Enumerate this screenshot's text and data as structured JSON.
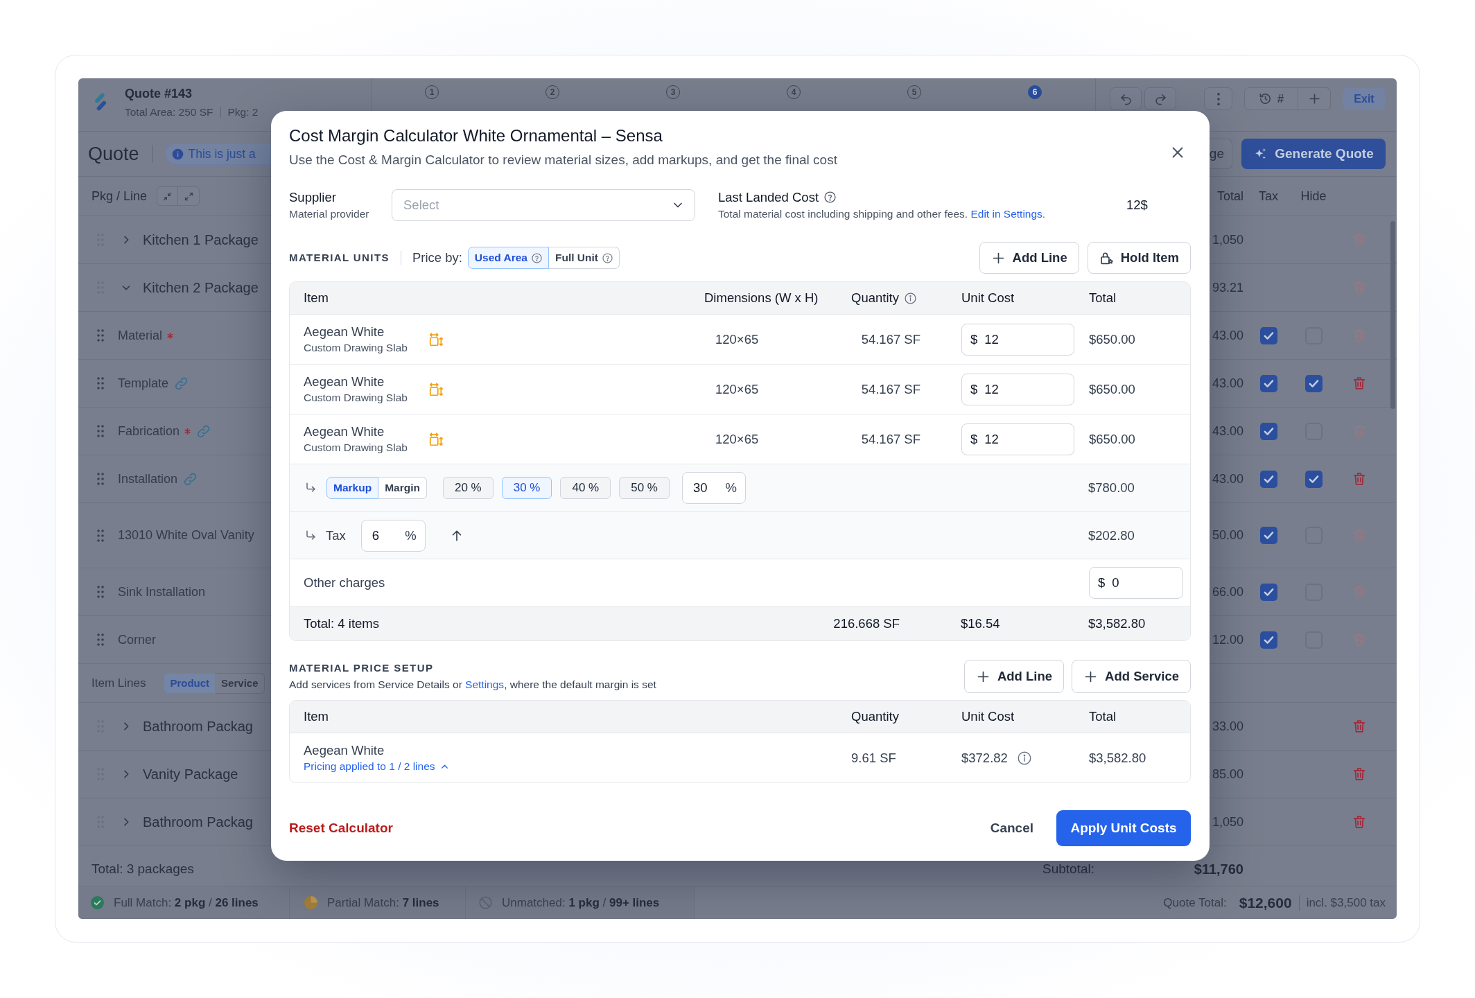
{
  "quote_app": {
    "header": {
      "title": "Quote #143",
      "total_area": "Total Area: 250 SF",
      "packages": "Pkg: 2"
    },
    "steps": [
      {
        "number": "1",
        "selected": false
      },
      {
        "number": "2",
        "selected": false
      },
      {
        "number": "3",
        "selected": false
      },
      {
        "number": "4",
        "selected": false
      },
      {
        "number": "5",
        "selected": false
      },
      {
        "number": "6",
        "selected": true
      }
    ],
    "toolbar": {
      "history_label": "#",
      "exit": "Exit"
    },
    "page_title": "Quote",
    "notice": "This is just a",
    "partial_button": "ge",
    "generate_button": "Generate Quote",
    "table": {
      "first_column": "Pkg / Line",
      "columns": [
        "Total",
        "Tax",
        "Hide"
      ],
      "rows": [
        {
          "kind": "package",
          "name": "Kitchen 1 Package",
          "expanded": false,
          "total": "1,050",
          "delete_disabled": true
        },
        {
          "kind": "package",
          "name": "Kitchen 2 Package",
          "expanded": true,
          "total": "93.21",
          "delete_disabled": true
        },
        {
          "kind": "line",
          "name": "Material",
          "required": true,
          "linked": false,
          "total": "43.00",
          "tax": true,
          "hide": false,
          "delete_disabled": true
        },
        {
          "kind": "line",
          "name": "Template",
          "required": false,
          "linked": true,
          "total": "43.00",
          "tax": true,
          "hide": true,
          "delete_disabled": false
        },
        {
          "kind": "line",
          "name": "Fabrication",
          "required": true,
          "linked": true,
          "total": "43.00",
          "tax": true,
          "hide": false,
          "delete_disabled": true
        },
        {
          "kind": "line",
          "name": "Installation",
          "required": false,
          "linked": true,
          "total": "43.00",
          "tax": true,
          "hide": true,
          "delete_disabled": false
        },
        {
          "kind": "product",
          "name": "13010 White Oval Vanity",
          "required": false,
          "linked": false,
          "total": "50.00",
          "tax": true,
          "hide": false,
          "delete_disabled": true
        },
        {
          "kind": "line",
          "name": "Sink Installation",
          "required": false,
          "linked": false,
          "total": "66.00",
          "tax": true,
          "hide": false,
          "delete_disabled": true
        },
        {
          "kind": "line",
          "name": "Corner",
          "required": false,
          "linked": false,
          "total": "12.00",
          "tax": true,
          "hide": false,
          "delete_disabled": true
        },
        {
          "kind": "filter",
          "label": "Item Lines",
          "tabs": [
            {
              "label": "Product",
              "selected": true
            },
            {
              "label": "Service",
              "selected": false
            }
          ]
        },
        {
          "kind": "package",
          "name": "Bathroom Packag",
          "expanded": false,
          "total": "33.00",
          "delete_disabled": false
        },
        {
          "kind": "package",
          "name": "Vanity Package",
          "expanded": false,
          "total": "85.00",
          "delete_disabled": false
        },
        {
          "kind": "package",
          "name": "Bathroom Packag",
          "expanded": false,
          "total": "1,050",
          "delete_disabled": false
        }
      ]
    },
    "footer": {
      "total": "Total: 3 packages",
      "subtotal_label": "Subtotal:",
      "subtotal": "$11,760"
    },
    "status_bar": {
      "matches": [
        {
          "kind": "full",
          "text": "Full Match: **2 pkg** / **26 lines**"
        },
        {
          "kind": "partial",
          "text": "Partial Match: **7 lines**"
        },
        {
          "kind": "unmatched",
          "text": "Unmatched: **1 pkg** / **99+ lines**"
        }
      ],
      "quote_total_label": "Quote Total:",
      "quote_total": "$12,600",
      "tax_note": "incl. $3,500 tax"
    }
  },
  "cost_margin_calculator": {
    "title": "Cost Margin Calculator White Ornamental – Sensa",
    "subtitle": "Use the Cost & Margin Calculator to review material sizes, add markups, and get the final cost",
    "supplier": {
      "label": "Supplier",
      "hint": "Material provider",
      "placeholder": "Select"
    },
    "last_landed_cost": {
      "label": "Last Landed Cost",
      "description": "Total material cost including shipping and other fees.",
      "link": "Edit in Settings.",
      "value": "12$"
    },
    "material_units": {
      "title": "MATERIAL UNITS",
      "price_by_label": "Price by:",
      "price_by": [
        {
          "label": "Used Area",
          "selected": true
        },
        {
          "label": "Full Unit",
          "selected": false
        }
      ],
      "buttons": [
        {
          "kind": "add",
          "label": "Add Line"
        },
        {
          "kind": "hold",
          "label": "Hold Item"
        }
      ],
      "columns": [
        "Item",
        "Dimensions (W x H)",
        "Quantity",
        "Unit Cost",
        "Total"
      ],
      "rows": [
        {
          "name": "Aegean White",
          "description": "Custom Drawing Slab",
          "dimensions": "120×65",
          "quantity": "54.167 SF",
          "currency": "$",
          "unit_cost": "12",
          "total": "$650.00"
        },
        {
          "name": "Aegean White",
          "description": "Custom Drawing Slab",
          "dimensions": "120×65",
          "quantity": "54.167 SF",
          "currency": "$",
          "unit_cost": "12",
          "total": "$650.00"
        },
        {
          "name": "Aegean White",
          "description": "Custom Drawing Slab",
          "dimensions": "120×65",
          "quantity": "54.167 SF",
          "currency": "$",
          "unit_cost": "12",
          "total": "$650.00"
        }
      ],
      "markup": {
        "modes": [
          {
            "label": "Markup",
            "selected": true
          },
          {
            "label": "Margin",
            "selected": false
          }
        ],
        "presets": [
          {
            "label": "20 %",
            "selected": false
          },
          {
            "label": "30 %",
            "selected": true
          },
          {
            "label": "40 %",
            "selected": false
          },
          {
            "label": "50 %",
            "selected": false
          }
        ],
        "value": "30",
        "unit": "%",
        "total": "$780.00"
      },
      "tax": {
        "label": "Tax",
        "value": "6",
        "unit": "%",
        "total": "$202.80"
      },
      "other_charges": {
        "label": "Other charges",
        "currency": "$",
        "value": "0"
      },
      "totals": {
        "label": "Total: 4 items",
        "quantity": "216.668 SF",
        "unit_cost": "$16.54",
        "total": "$3,582.80"
      }
    },
    "price_setup": {
      "title": "MATERIAL PRICE SETUP",
      "description": {
        "before": "Add services from Service Details or",
        "link": "Settings",
        "after": ", where the default margin is set"
      },
      "buttons": [
        {
          "kind": "add",
          "label": "Add Line"
        },
        {
          "kind": "add",
          "label": "Add Service"
        }
      ],
      "columns": [
        "Item",
        "Quantity",
        "Unit Cost",
        "Total"
      ],
      "rows": [
        {
          "name": "Aegean White",
          "pricing": "Pricing applied to 1 / 2 lines",
          "expanded": true,
          "quantity": "9.61 SF",
          "unit_cost": "$372.82",
          "total": "$3,582.80"
        }
      ]
    },
    "footer": {
      "reset": "Reset Calculator",
      "cancel": "Cancel",
      "apply": "Apply Unit Costs"
    }
  }
}
